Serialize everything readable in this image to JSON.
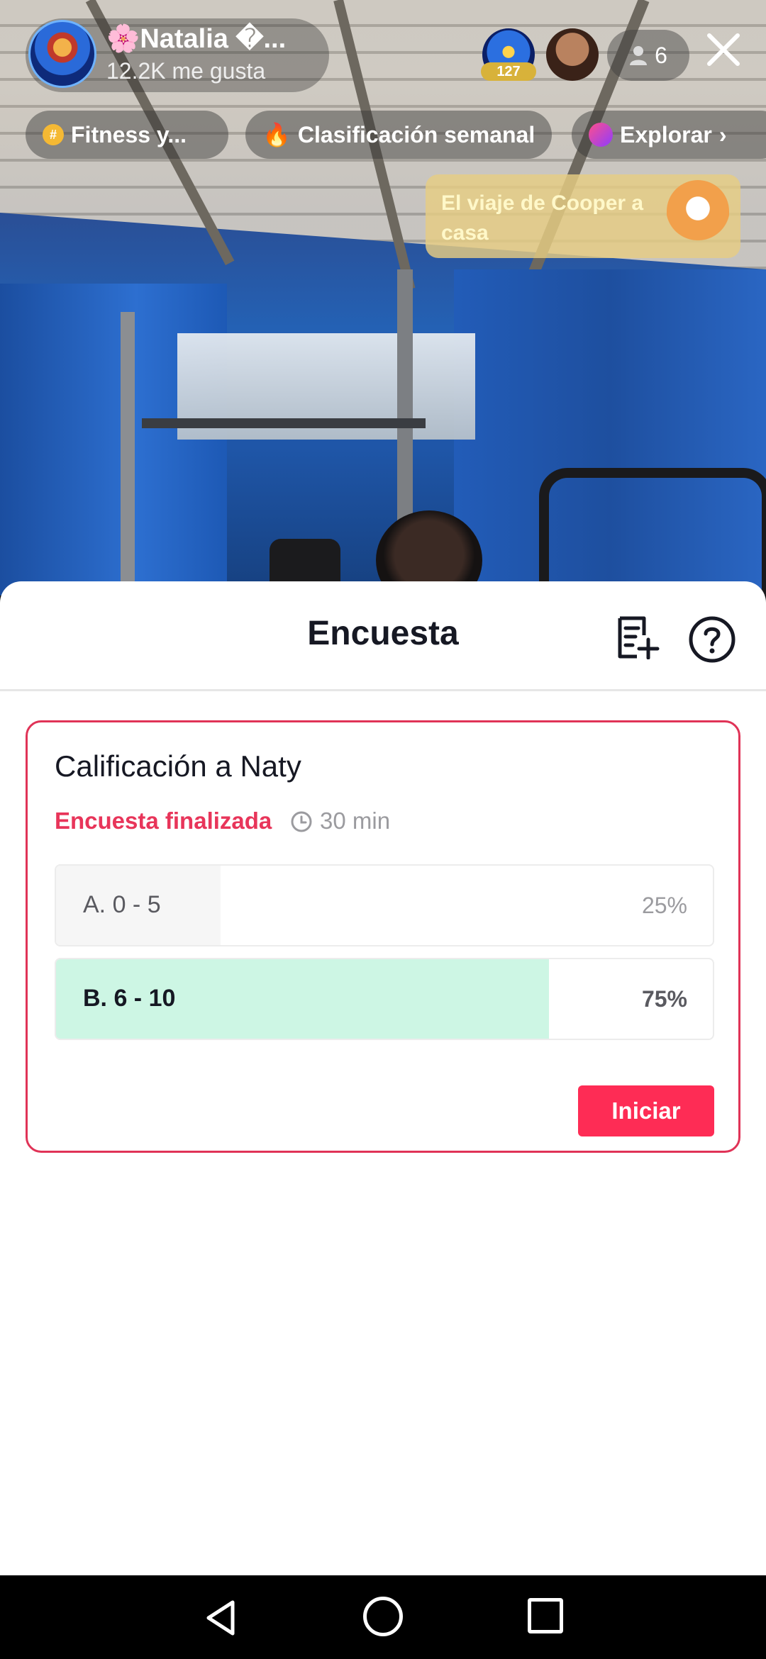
{
  "host": {
    "name": "🌸Natalia �...",
    "likes": "12.2K me gusta"
  },
  "viewers": {
    "badge": "127",
    "count": "6"
  },
  "chips": [
    {
      "label": "Fitness y..."
    },
    {
      "label": "Clasificación semanal"
    },
    {
      "label": "Explorar"
    }
  ],
  "promo": {
    "text": "El viaje de Cooper a casa"
  },
  "sheet": {
    "title": "Encuesta"
  },
  "poll": {
    "question": "Calificación a Naty",
    "status": "Encuesta finalizada",
    "time": "30 min",
    "options": [
      {
        "label": "A. 0 - 5",
        "percent_text": "25%",
        "share": 0.25
      },
      {
        "label": "B. 6 - 10",
        "percent_text": "75%",
        "share": 0.75
      }
    ],
    "start_label": "Iniciar"
  },
  "colors": {
    "accent": "#fe2c55",
    "winner_fill": "#cdf6e4"
  },
  "icons": {
    "close": "close-icon",
    "person": "person-icon",
    "add_list": "add-list-icon",
    "help": "help-icon",
    "clock": "clock-icon"
  }
}
